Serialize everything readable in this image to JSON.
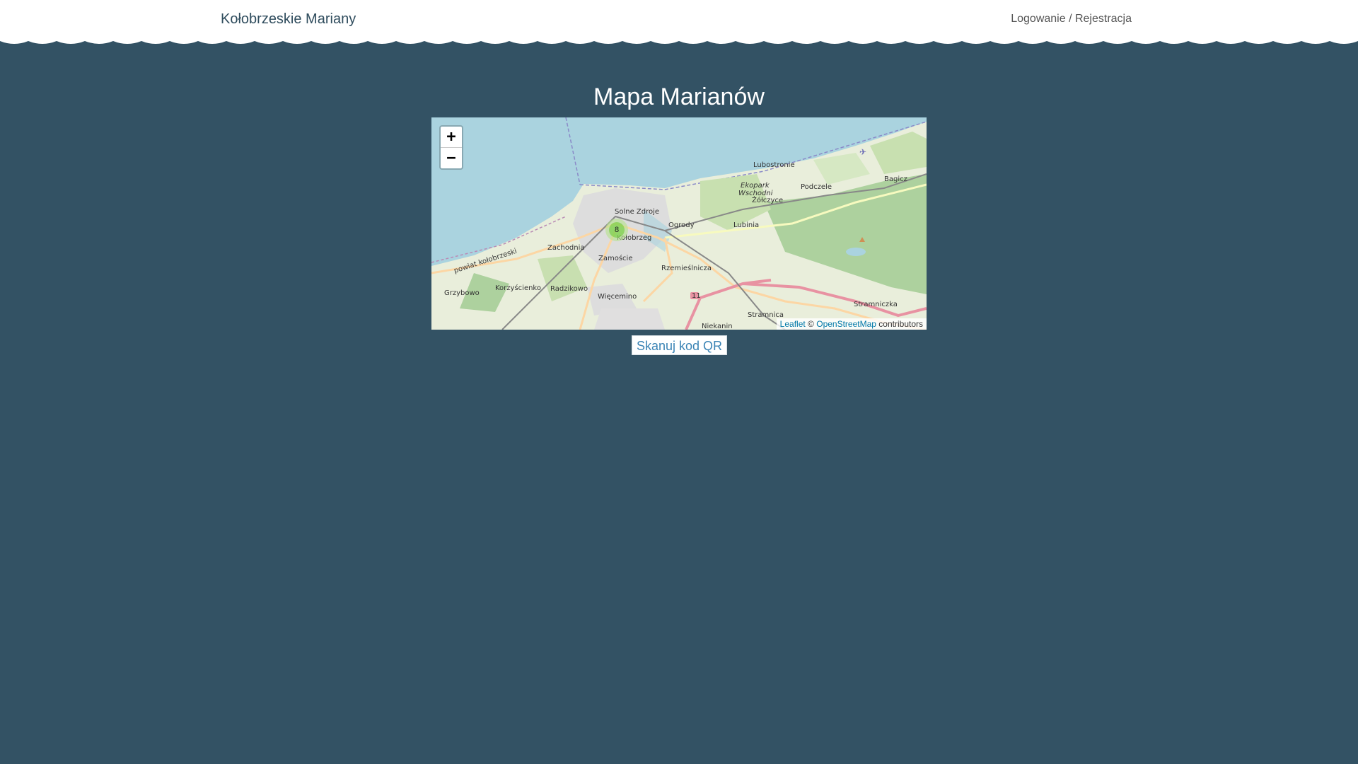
{
  "header": {
    "brand": "Kołobrzeskie Mariany",
    "auth_link": "Logowanie / Rejestracja"
  },
  "main": {
    "title": "Mapa Marianów",
    "qr_button": "Skanuj kod QR"
  },
  "map": {
    "zoom_in": "+",
    "zoom_out": "−",
    "cluster_count": "8",
    "attribution": {
      "leaflet": "Leaflet",
      "copyright": "©",
      "osm": "OpenStreetMap",
      "contributors": "contributors"
    },
    "place_labels": {
      "lubostronie": "Lubostronie",
      "podczele": "Podczele",
      "bagicz": "Bagicz",
      "ekopark": "Ekopark",
      "wschodni": "Wschodni",
      "zolczyce": "Żółczyce",
      "solne_zdroje": "Solne Zdroje",
      "ogrody": "Ogrody",
      "lubinia": "Lubinia",
      "kolobrzeg": "Kołobrzeg",
      "zachodnia": "Zachodnia",
      "zamoscie": "Zamoście",
      "rzemieslnicza": "Rzemieślnicza",
      "powiat": "powiat kołobrzeski",
      "grzybowo": "Grzybowo",
      "korzyscienko": "Korzyścienko",
      "radzikowo": "Radzikowo",
      "wiecemino": "Więcemino",
      "stramniczka": "Stramniczka",
      "stramnica": "Stramnica",
      "niekanin": "Niekanin",
      "road_number": "11"
    }
  },
  "colors": {
    "background": "#335264",
    "header": "#ffffff",
    "brand_text": "#2f4c5d",
    "sea": "#aad3df",
    "land": "#e9eedb",
    "cluster": "#6ecc39"
  }
}
